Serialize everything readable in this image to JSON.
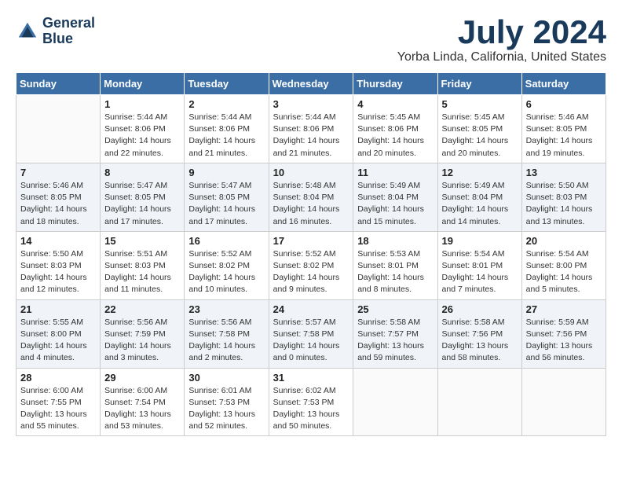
{
  "header": {
    "logo_line1": "General",
    "logo_line2": "Blue",
    "month_year": "July 2024",
    "location": "Yorba Linda, California, United States"
  },
  "weekdays": [
    "Sunday",
    "Monday",
    "Tuesday",
    "Wednesday",
    "Thursday",
    "Friday",
    "Saturday"
  ],
  "weeks": [
    [
      {
        "day": "",
        "info": ""
      },
      {
        "day": "1",
        "info": "Sunrise: 5:44 AM\nSunset: 8:06 PM\nDaylight: 14 hours\nand 22 minutes."
      },
      {
        "day": "2",
        "info": "Sunrise: 5:44 AM\nSunset: 8:06 PM\nDaylight: 14 hours\nand 21 minutes."
      },
      {
        "day": "3",
        "info": "Sunrise: 5:44 AM\nSunset: 8:06 PM\nDaylight: 14 hours\nand 21 minutes."
      },
      {
        "day": "4",
        "info": "Sunrise: 5:45 AM\nSunset: 8:06 PM\nDaylight: 14 hours\nand 20 minutes."
      },
      {
        "day": "5",
        "info": "Sunrise: 5:45 AM\nSunset: 8:05 PM\nDaylight: 14 hours\nand 20 minutes."
      },
      {
        "day": "6",
        "info": "Sunrise: 5:46 AM\nSunset: 8:05 PM\nDaylight: 14 hours\nand 19 minutes."
      }
    ],
    [
      {
        "day": "7",
        "info": "Sunrise: 5:46 AM\nSunset: 8:05 PM\nDaylight: 14 hours\nand 18 minutes."
      },
      {
        "day": "8",
        "info": "Sunrise: 5:47 AM\nSunset: 8:05 PM\nDaylight: 14 hours\nand 17 minutes."
      },
      {
        "day": "9",
        "info": "Sunrise: 5:47 AM\nSunset: 8:05 PM\nDaylight: 14 hours\nand 17 minutes."
      },
      {
        "day": "10",
        "info": "Sunrise: 5:48 AM\nSunset: 8:04 PM\nDaylight: 14 hours\nand 16 minutes."
      },
      {
        "day": "11",
        "info": "Sunrise: 5:49 AM\nSunset: 8:04 PM\nDaylight: 14 hours\nand 15 minutes."
      },
      {
        "day": "12",
        "info": "Sunrise: 5:49 AM\nSunset: 8:04 PM\nDaylight: 14 hours\nand 14 minutes."
      },
      {
        "day": "13",
        "info": "Sunrise: 5:50 AM\nSunset: 8:03 PM\nDaylight: 14 hours\nand 13 minutes."
      }
    ],
    [
      {
        "day": "14",
        "info": "Sunrise: 5:50 AM\nSunset: 8:03 PM\nDaylight: 14 hours\nand 12 minutes."
      },
      {
        "day": "15",
        "info": "Sunrise: 5:51 AM\nSunset: 8:03 PM\nDaylight: 14 hours\nand 11 minutes."
      },
      {
        "day": "16",
        "info": "Sunrise: 5:52 AM\nSunset: 8:02 PM\nDaylight: 14 hours\nand 10 minutes."
      },
      {
        "day": "17",
        "info": "Sunrise: 5:52 AM\nSunset: 8:02 PM\nDaylight: 14 hours\nand 9 minutes."
      },
      {
        "day": "18",
        "info": "Sunrise: 5:53 AM\nSunset: 8:01 PM\nDaylight: 14 hours\nand 8 minutes."
      },
      {
        "day": "19",
        "info": "Sunrise: 5:54 AM\nSunset: 8:01 PM\nDaylight: 14 hours\nand 7 minutes."
      },
      {
        "day": "20",
        "info": "Sunrise: 5:54 AM\nSunset: 8:00 PM\nDaylight: 14 hours\nand 5 minutes."
      }
    ],
    [
      {
        "day": "21",
        "info": "Sunrise: 5:55 AM\nSunset: 8:00 PM\nDaylight: 14 hours\nand 4 minutes."
      },
      {
        "day": "22",
        "info": "Sunrise: 5:56 AM\nSunset: 7:59 PM\nDaylight: 14 hours\nand 3 minutes."
      },
      {
        "day": "23",
        "info": "Sunrise: 5:56 AM\nSunset: 7:58 PM\nDaylight: 14 hours\nand 2 minutes."
      },
      {
        "day": "24",
        "info": "Sunrise: 5:57 AM\nSunset: 7:58 PM\nDaylight: 14 hours\nand 0 minutes."
      },
      {
        "day": "25",
        "info": "Sunrise: 5:58 AM\nSunset: 7:57 PM\nDaylight: 13 hours\nand 59 minutes."
      },
      {
        "day": "26",
        "info": "Sunrise: 5:58 AM\nSunset: 7:56 PM\nDaylight: 13 hours\nand 58 minutes."
      },
      {
        "day": "27",
        "info": "Sunrise: 5:59 AM\nSunset: 7:56 PM\nDaylight: 13 hours\nand 56 minutes."
      }
    ],
    [
      {
        "day": "28",
        "info": "Sunrise: 6:00 AM\nSunset: 7:55 PM\nDaylight: 13 hours\nand 55 minutes."
      },
      {
        "day": "29",
        "info": "Sunrise: 6:00 AM\nSunset: 7:54 PM\nDaylight: 13 hours\nand 53 minutes."
      },
      {
        "day": "30",
        "info": "Sunrise: 6:01 AM\nSunset: 7:53 PM\nDaylight: 13 hours\nand 52 minutes."
      },
      {
        "day": "31",
        "info": "Sunrise: 6:02 AM\nSunset: 7:53 PM\nDaylight: 13 hours\nand 50 minutes."
      },
      {
        "day": "",
        "info": ""
      },
      {
        "day": "",
        "info": ""
      },
      {
        "day": "",
        "info": ""
      }
    ]
  ]
}
